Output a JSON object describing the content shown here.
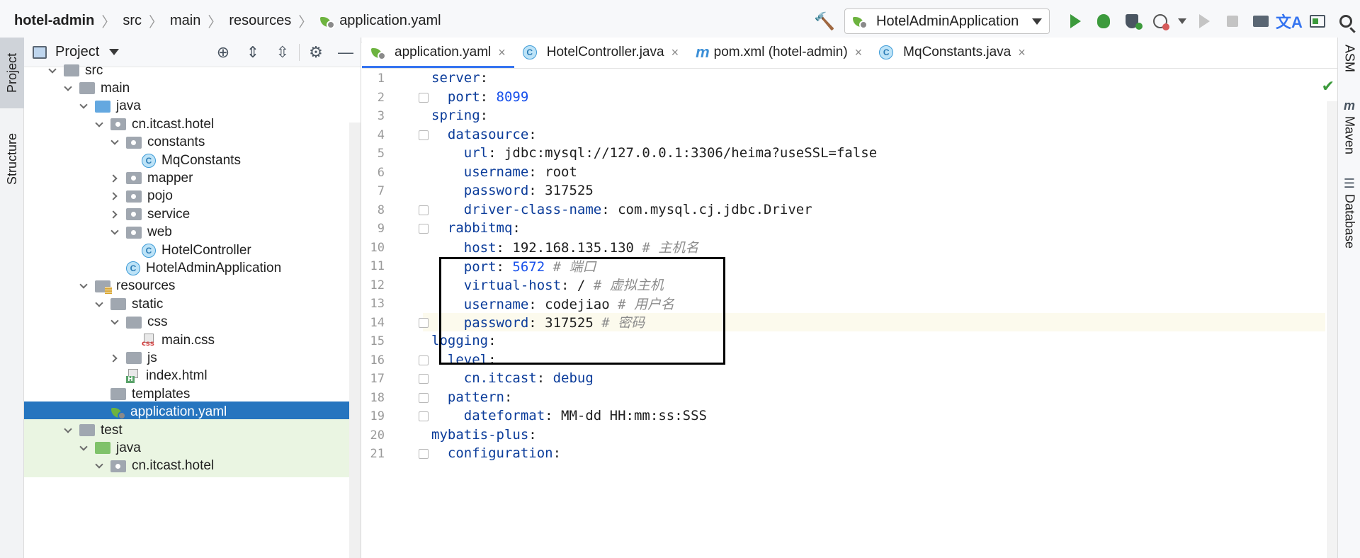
{
  "breadcrumbs": [
    "hotel-admin",
    "src",
    "main",
    "resources",
    "application.yaml"
  ],
  "run_config": {
    "label": "HotelAdminApplication"
  },
  "left_strip": {
    "project_label": "Project",
    "structure_label": "Structure"
  },
  "right_strip": {
    "asm_label": "ASM",
    "maven_label": "Maven",
    "database_label": "Database",
    "maven_icon": "m"
  },
  "project_panel": {
    "title": "Project",
    "tree": [
      {
        "label": "src",
        "type": "folder",
        "expanded": true
      },
      {
        "label": "main",
        "type": "folder",
        "expanded": true
      },
      {
        "label": "java",
        "type": "folder-blue",
        "expanded": true
      },
      {
        "label": "cn.itcast.hotel",
        "type": "package",
        "expanded": true
      },
      {
        "label": "constants",
        "type": "package",
        "expanded": true
      },
      {
        "label": "MqConstants",
        "type": "class"
      },
      {
        "label": "mapper",
        "type": "package",
        "expanded": false
      },
      {
        "label": "pojo",
        "type": "package",
        "expanded": false
      },
      {
        "label": "service",
        "type": "package",
        "expanded": false
      },
      {
        "label": "web",
        "type": "package",
        "expanded": true
      },
      {
        "label": "HotelController",
        "type": "class"
      },
      {
        "label": "HotelAdminApplication",
        "type": "class-app"
      },
      {
        "label": "resources",
        "type": "folder-res",
        "expanded": true
      },
      {
        "label": "static",
        "type": "folder",
        "expanded": true
      },
      {
        "label": "css",
        "type": "folder",
        "expanded": true
      },
      {
        "label": "main.css",
        "type": "css"
      },
      {
        "label": "js",
        "type": "folder",
        "expanded": false
      },
      {
        "label": "index.html",
        "type": "html"
      },
      {
        "label": "templates",
        "type": "folder"
      },
      {
        "label": "application.yaml",
        "type": "yaml",
        "selected": true
      },
      {
        "label": "test",
        "type": "folder",
        "expanded": true
      },
      {
        "label": "java",
        "type": "folder-green",
        "expanded": true
      },
      {
        "label": "cn.itcast.hotel",
        "type": "package",
        "expanded": true
      }
    ]
  },
  "editor": {
    "tabs": [
      {
        "label": "application.yaml",
        "icon": "yaml",
        "active": true
      },
      {
        "label": "HotelController.java",
        "icon": "class"
      },
      {
        "label": "pom.xml (hotel-admin)",
        "icon": "maven"
      },
      {
        "label": "MqConstants.java",
        "icon": "class"
      }
    ],
    "close_glyph": "×",
    "current_line": 14,
    "lines": [
      {
        "n": "1",
        "key": "server",
        "sep": ":",
        "val": "",
        "valtype": "",
        "comment": ""
      },
      {
        "n": "2",
        "key": "  port",
        "sep": ": ",
        "val": "8099",
        "valtype": "num",
        "comment": ""
      },
      {
        "n": "3",
        "key": "spring",
        "sep": ":",
        "val": "",
        "valtype": "",
        "comment": ""
      },
      {
        "n": "4",
        "key": "  datasource",
        "sep": ":",
        "val": "",
        "valtype": "",
        "comment": ""
      },
      {
        "n": "5",
        "key": "    url",
        "sep": ": ",
        "val": "jdbc:mysql://127.0.0.1:3306/heima?useSSL=false",
        "valtype": "str",
        "comment": ""
      },
      {
        "n": "6",
        "key": "    username",
        "sep": ": ",
        "val": "root",
        "valtype": "str",
        "comment": ""
      },
      {
        "n": "7",
        "key": "    password",
        "sep": ": ",
        "val": "317525",
        "valtype": "str",
        "comment": ""
      },
      {
        "n": "8",
        "key": "    driver-class-name",
        "sep": ": ",
        "val": "com.mysql.cj.jdbc.Driver",
        "valtype": "str",
        "comment": ""
      },
      {
        "n": "9",
        "key": "  rabbitmq",
        "sep": ":",
        "val": "",
        "valtype": "",
        "comment": ""
      },
      {
        "n": "10",
        "key": "    host",
        "sep": ": ",
        "val": "192.168.135.130",
        "valtype": "str",
        "comment": " # 主机名"
      },
      {
        "n": "11",
        "key": "    port",
        "sep": ": ",
        "val": "5672",
        "valtype": "num",
        "comment": " # 端口"
      },
      {
        "n": "12",
        "key": "    virtual-host",
        "sep": ": ",
        "val": "/",
        "valtype": "str",
        "comment": " # 虚拟主机"
      },
      {
        "n": "13",
        "key": "    username",
        "sep": ": ",
        "val": "codejiao",
        "valtype": "str",
        "comment": " # 用户名"
      },
      {
        "n": "14",
        "key": "    password",
        "sep": ": ",
        "val": "317525",
        "valtype": "str",
        "comment": " # 密码"
      },
      {
        "n": "15",
        "key": "logging",
        "sep": ":",
        "val": "",
        "valtype": "",
        "comment": ""
      },
      {
        "n": "16",
        "key": "  level",
        "sep": ":",
        "val": "",
        "valtype": "",
        "comment": ""
      },
      {
        "n": "17",
        "key": "    cn.itcast",
        "sep": ": ",
        "val": "debug",
        "valtype": "kw",
        "comment": ""
      },
      {
        "n": "18",
        "key": "  pattern",
        "sep": ":",
        "val": "",
        "valtype": "",
        "comment": ""
      },
      {
        "n": "19",
        "key": "    dateformat",
        "sep": ": ",
        "val": "MM-dd HH:mm:ss:SSS",
        "valtype": "str",
        "comment": ""
      },
      {
        "n": "20",
        "key": "mybatis-plus",
        "sep": ":",
        "val": "",
        "valtype": "",
        "comment": ""
      },
      {
        "n": "21",
        "key": "  configuration",
        "sep": ":",
        "val": "",
        "valtype": "",
        "comment": ""
      }
    ],
    "fold_lines": [
      2,
      4,
      8,
      9,
      14,
      16,
      17,
      18,
      19,
      21
    ]
  },
  "colors": {
    "accent": "#3574f0",
    "selection": "#2675bf",
    "yaml_key": "#0b3c9a",
    "number": "#1750eb"
  }
}
